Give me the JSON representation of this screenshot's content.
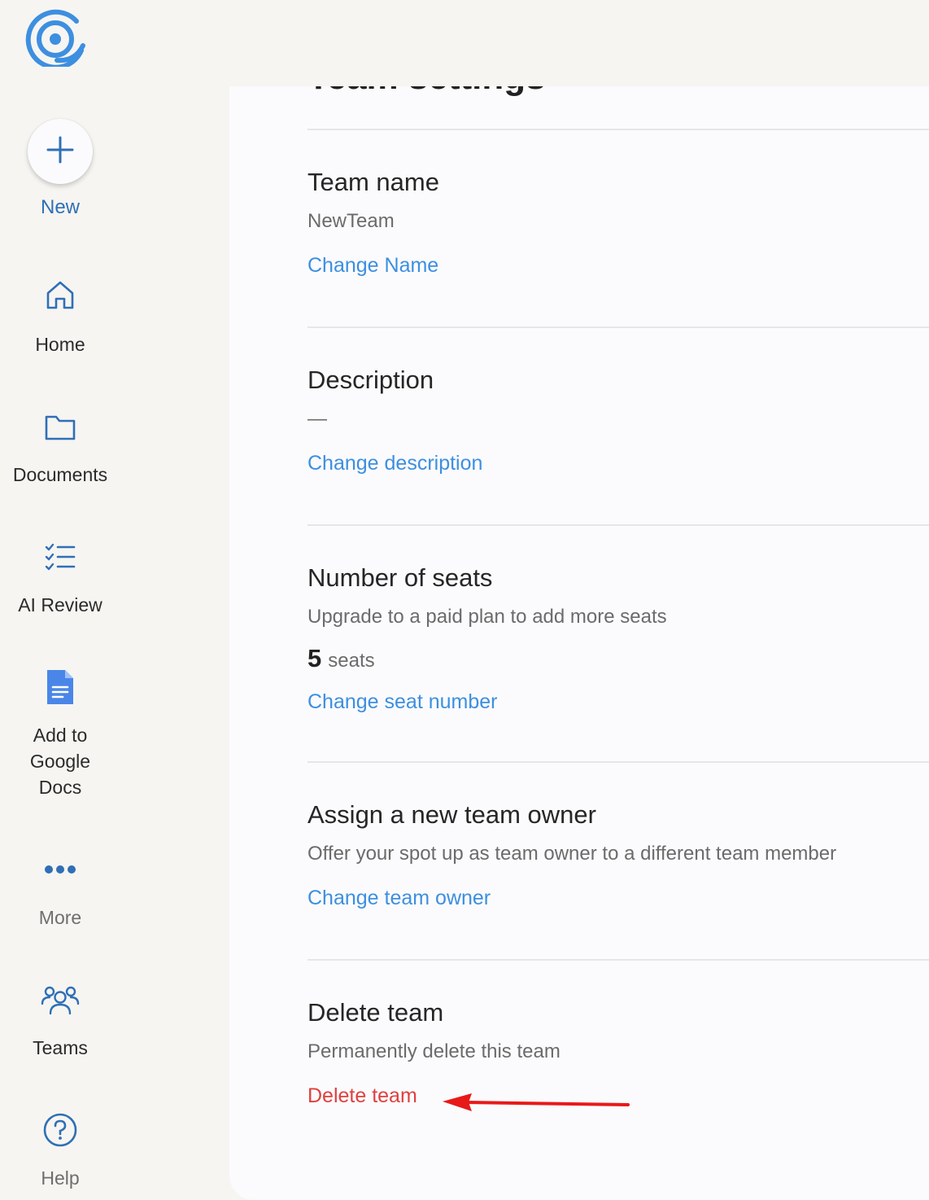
{
  "colors": {
    "accent": "#3d8fe0",
    "icon_blue": "#2f6fb6",
    "danger": "#e0403e",
    "arrow": "#e81919",
    "sidebar_bg": "#f6f5f2",
    "panel_bg": "#fbfbfd"
  },
  "sidebar": {
    "logo_icon": "app-logo-icon",
    "new_button": {
      "label": "New",
      "icon": "plus-icon"
    },
    "items": [
      {
        "id": "home",
        "label": "Home",
        "icon": "home-icon"
      },
      {
        "id": "documents",
        "label": "Documents",
        "icon": "folder-icon"
      },
      {
        "id": "ai-review",
        "label": "AI Review",
        "icon": "checklist-icon"
      },
      {
        "id": "google-docs",
        "label": "Add to\nGoogle\nDocs",
        "icon": "google-docs-icon"
      },
      {
        "id": "more",
        "label": "More",
        "icon": "more-dots-icon"
      },
      {
        "id": "teams",
        "label": "Teams",
        "icon": "teams-icon"
      },
      {
        "id": "help",
        "label": "Help",
        "icon": "help-icon"
      }
    ]
  },
  "page": {
    "title": "Team settings"
  },
  "sections": {
    "team_name": {
      "title": "Team name",
      "value": "NewTeam",
      "link": "Change Name"
    },
    "description": {
      "title": "Description",
      "value": "—",
      "link": "Change description"
    },
    "seats": {
      "title": "Number of seats",
      "text": "Upgrade to a paid plan to add more seats",
      "count": "5",
      "unit": "seats",
      "link": "Change seat number"
    },
    "owner": {
      "title": "Assign a new team owner",
      "text": "Offer your spot up as team owner to a different team member",
      "link": "Change team owner"
    },
    "delete": {
      "title": "Delete team",
      "text": "Permanently delete this team",
      "link": "Delete team"
    }
  },
  "annotation": {
    "type": "arrow",
    "points_to": "delete-team-link"
  }
}
